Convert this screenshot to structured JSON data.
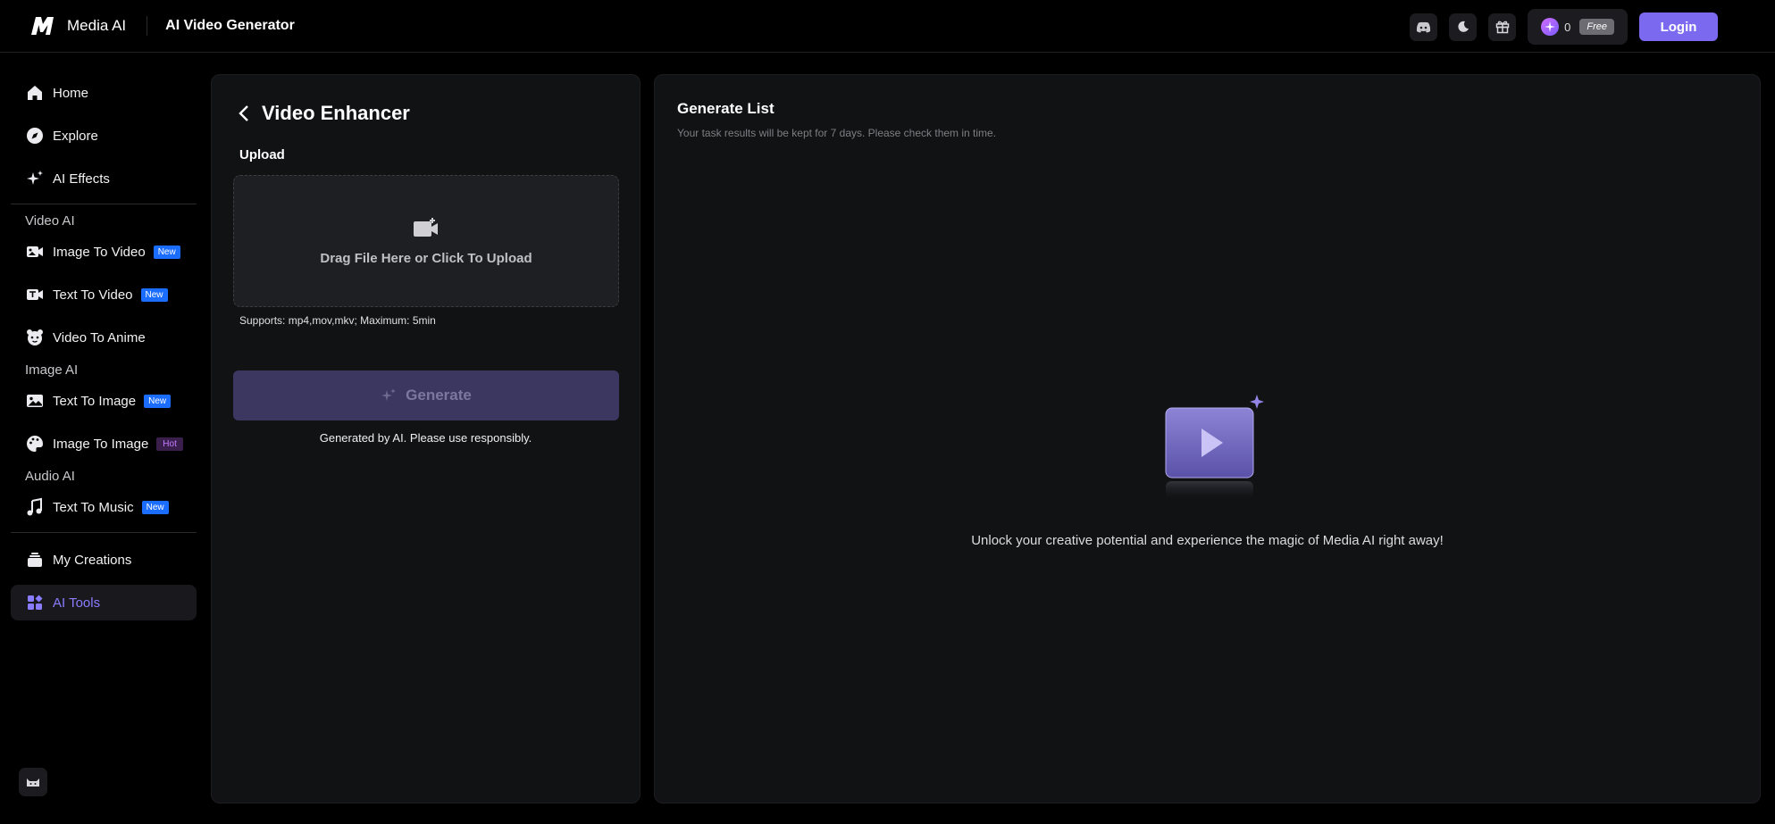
{
  "header": {
    "brand": "Media AI",
    "page_title": "AI Video Generator",
    "credits": "0",
    "plan_badge": "Free",
    "login_label": "Login"
  },
  "sidebar": {
    "items_top": [
      {
        "label": "Home",
        "icon": "home-icon"
      },
      {
        "label": "Explore",
        "icon": "compass-icon"
      },
      {
        "label": "AI Effects",
        "icon": "sparkle-icon"
      }
    ],
    "groups": [
      {
        "title": "Video AI",
        "items": [
          {
            "label": "Image To Video",
            "badge": "New"
          },
          {
            "label": "Text To Video",
            "badge": "New"
          },
          {
            "label": "Video To Anime",
            "badge": ""
          }
        ]
      },
      {
        "title": "Image AI",
        "items": [
          {
            "label": "Text To Image",
            "badge": "New"
          },
          {
            "label": "Image To Image",
            "badge": "Hot"
          }
        ]
      },
      {
        "title": "Audio AI",
        "items": [
          {
            "label": "Text To Music",
            "badge": "New"
          }
        ]
      }
    ],
    "items_bottom": [
      {
        "label": "My Creations"
      },
      {
        "label": "AI Tools"
      }
    ]
  },
  "tool": {
    "title": "Video Enhancer",
    "upload_label": "Upload",
    "drop_text": "Drag File Here or Click To Upload",
    "supports": "Supports: mp4,mov,mkv; Maximum: 5min",
    "generate_label": "Generate",
    "disclaimer": "Generated by AI. Please use responsibly."
  },
  "generate_list": {
    "title": "Generate List",
    "subtitle": "Your task results will be kept for 7 days. Please check them in time.",
    "empty_message": "Unlock your creative potential and experience the magic of Media AI right away!"
  },
  "colors": {
    "accent": "#7b6af0",
    "active_nav": "#8a7cff",
    "badge_new": "#1a6dff",
    "badge_hot": "#c67aff"
  }
}
